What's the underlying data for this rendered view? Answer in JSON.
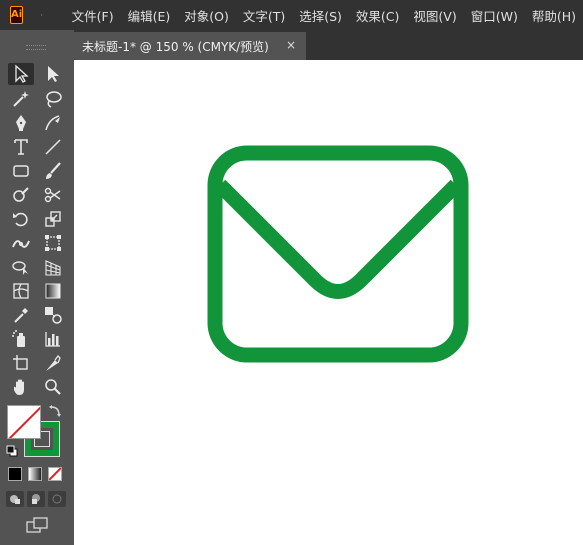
{
  "app": {
    "logo_text": "Ai",
    "menu": [
      "文件(F)",
      "编辑(E)",
      "对象(O)",
      "文字(T)",
      "选择(S)",
      "效果(C)",
      "视图(V)",
      "窗口(W)",
      "帮助(H)"
    ]
  },
  "document_tab": {
    "title": "未标题-1* @ 150 % (CMYK/预览)",
    "close_glyph": "×"
  },
  "panel": {
    "collapse_glyph": "◂◂"
  },
  "colors": {
    "stroke": "#12943a",
    "fill": "none",
    "ui_dark": "#323232",
    "ui_panel": "#535353"
  },
  "tools": [
    [
      "selection-tool",
      "direct-selection-tool"
    ],
    [
      "magic-wand-tool",
      "lasso-tool"
    ],
    [
      "pen-tool",
      "curvature-tool"
    ],
    [
      "type-tool",
      "line-segment-tool"
    ],
    [
      "rectangle-tool",
      "paintbrush-tool"
    ],
    [
      "shaper-tool",
      "scissors-tool"
    ],
    [
      "rotate-tool",
      "scale-tool"
    ],
    [
      "width-tool",
      "free-transform-tool"
    ],
    [
      "shape-builder-tool",
      "perspective-grid-tool"
    ],
    [
      "mesh-tool",
      "gradient-tool"
    ],
    [
      "eyedropper-tool",
      "blend-tool"
    ],
    [
      "symbol-sprayer-tool",
      "column-graph-tool"
    ],
    [
      "artboard-tool",
      "slice-tool"
    ],
    [
      "hand-tool",
      "zoom-tool"
    ]
  ]
}
